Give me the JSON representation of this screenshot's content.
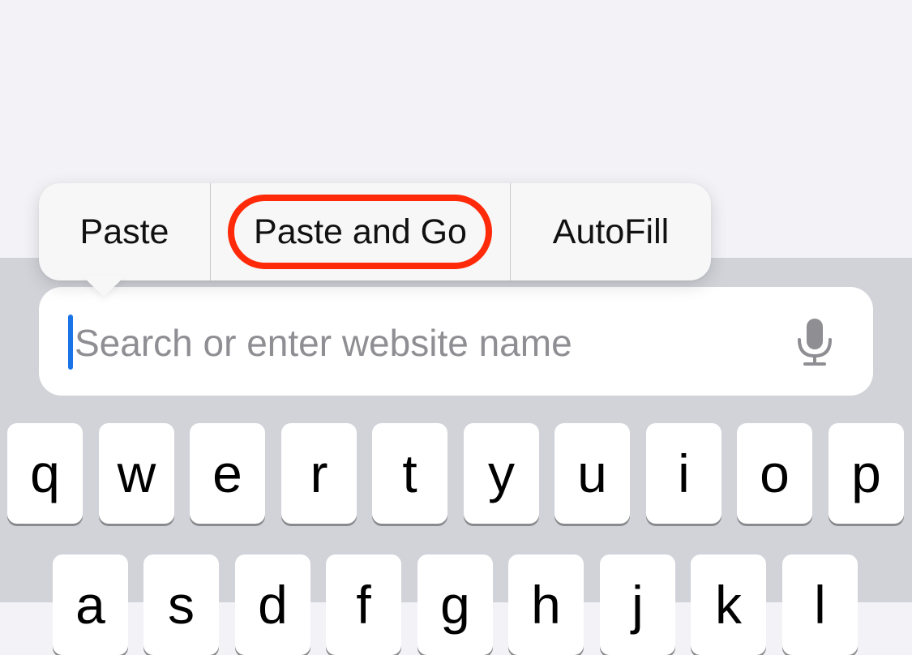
{
  "popover_menu": {
    "items": [
      {
        "label": "Paste"
      },
      {
        "label": "Paste and Go"
      },
      {
        "label": "AutoFill"
      }
    ],
    "highlighted_item": "Paste and Go",
    "highlight_color": "#ff2a0a"
  },
  "search": {
    "placeholder": "Search or enter website name",
    "value": "",
    "caret_color": "#1a74e8",
    "mic_icon": "microphone-icon"
  },
  "keyboard": {
    "row1": [
      "q",
      "w",
      "e",
      "r",
      "t",
      "y",
      "u",
      "i",
      "o",
      "p"
    ],
    "row2": [
      "a",
      "s",
      "d",
      "f",
      "g",
      "h",
      "j",
      "k",
      "l"
    ]
  },
  "colors": {
    "page_background": "#f2f2f7",
    "keyboard_background": "#d1d3d9",
    "key_background": "#ffffff",
    "placeholder_text": "#8e8e93"
  }
}
